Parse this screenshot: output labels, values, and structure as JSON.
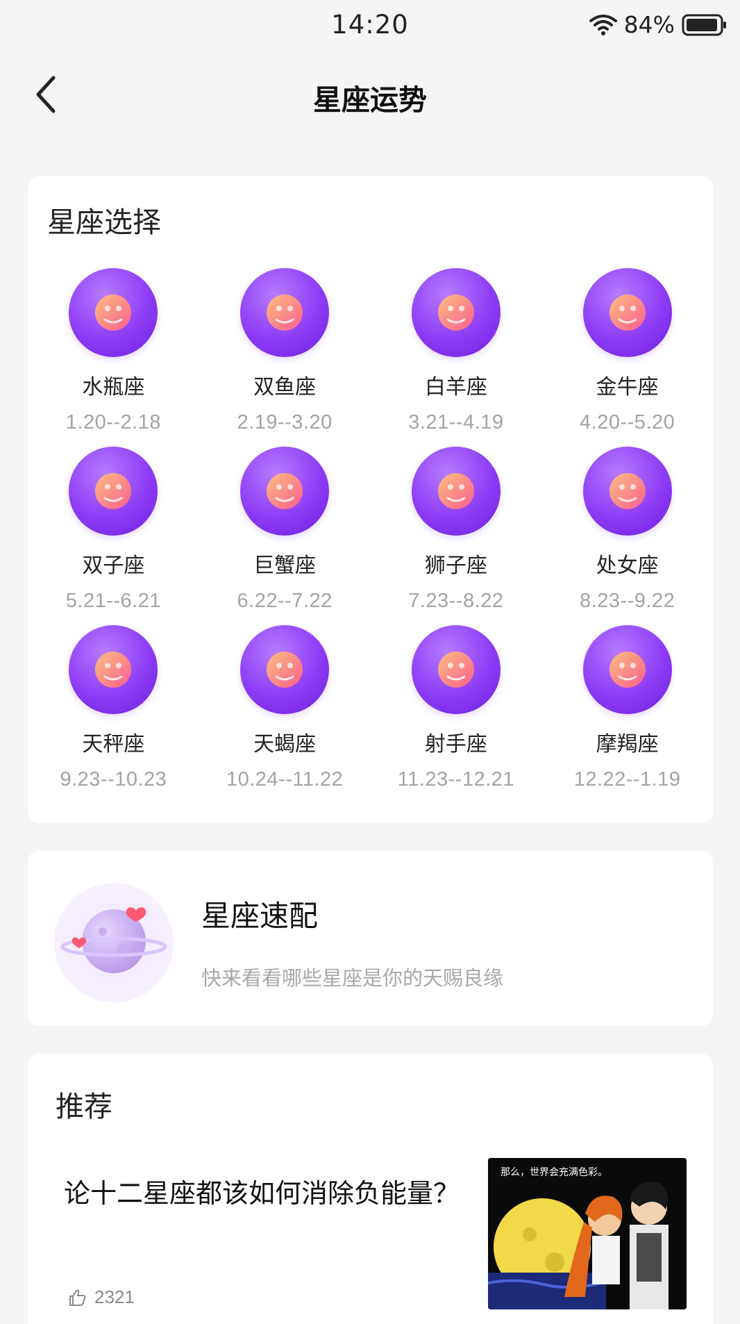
{
  "status_bar": {
    "time": "14:20",
    "battery": "84%"
  },
  "header": {
    "title": "星座运势"
  },
  "zodiac_section": {
    "title": "星座选择",
    "items": [
      {
        "name": "水瓶座",
        "dates": "1.20--2.18",
        "icon": "aquarius-icon"
      },
      {
        "name": "双鱼座",
        "dates": "2.19--3.20",
        "icon": "pisces-icon"
      },
      {
        "name": "白羊座",
        "dates": "3.21--4.19",
        "icon": "aries-icon"
      },
      {
        "name": "金牛座",
        "dates": "4.20--5.20",
        "icon": "taurus-icon"
      },
      {
        "name": "双子座",
        "dates": "5.21--6.21",
        "icon": "gemini-icon"
      },
      {
        "name": "巨蟹座",
        "dates": "6.22--7.22",
        "icon": "cancer-icon"
      },
      {
        "name": "狮子座",
        "dates": "7.23--8.22",
        "icon": "leo-icon"
      },
      {
        "name": "处女座",
        "dates": "8.23--9.22",
        "icon": "virgo-icon"
      },
      {
        "name": "天秤座",
        "dates": "9.23--10.23",
        "icon": "libra-icon"
      },
      {
        "name": "天蝎座",
        "dates": "10.24--11.22",
        "icon": "scorpio-icon"
      },
      {
        "name": "射手座",
        "dates": "11.23--12.21",
        "icon": "sagittarius-icon"
      },
      {
        "name": "摩羯座",
        "dates": "12.22--1.19",
        "icon": "capricorn-icon"
      }
    ]
  },
  "match": {
    "title": "星座速配",
    "subtitle": "快来看看哪些星座是你的天赐良缘"
  },
  "recommend": {
    "title": "推荐",
    "article": {
      "title": "论十二星座都该如何消除负能量？",
      "likes": "2321",
      "thumb_caption": "那么，世界会充满色彩。"
    }
  },
  "colors": {
    "accent": "#8d3cf5",
    "icon_motif": "#ffa26b"
  }
}
